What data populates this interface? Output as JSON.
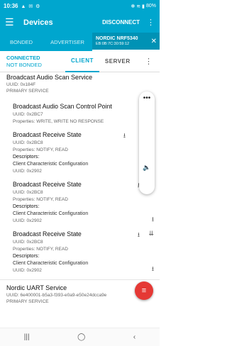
{
  "status": {
    "time": "10:36",
    "left_icons": "▲ ✉ ⚙",
    "right_icons": "✻ ≋ ▮",
    "battery": "80%"
  },
  "app": {
    "title": "Devices",
    "disconnect": "DISCONNECT"
  },
  "tabs": {
    "bonded": "BONDED",
    "advertiser": "ADVERTISER",
    "device_name": "NORDIC NRF5340",
    "device_mac": "EB:0B:7C:30:59:12"
  },
  "conn": {
    "status": "CONNECTED",
    "bond": "NOT BONDED",
    "client": "CLIENT",
    "server": "SERVER"
  },
  "services": [
    {
      "name": "Broadcast Audio Scan Service",
      "uuid": "UUID: 0x184F",
      "type": "PRIMARY SERVICE"
    },
    {
      "name": "Nordic UART Service",
      "uuid": "UUID: 6e400001-b5a3-f393-e0a9-e50e24dcca9e",
      "type": "PRIMARY SERVICE"
    }
  ],
  "chars": [
    {
      "name": "Broadcast Audio Scan Control Point",
      "uuid": "UUID: 0x2BC7",
      "props": "Properties: WRITE, WRITE NO RESPONSE"
    },
    {
      "name": "Broadcast Receive State",
      "uuid": "UUID: 0x2BC8",
      "props": "Properties: NOTIFY, READ",
      "desc_label": "Descriptors:",
      "desc_name": "Client Characteristic Configuration",
      "desc_uuid": "UUID: 0x2902"
    },
    {
      "name": "Broadcast Receive State",
      "uuid": "UUID: 0x2BC8",
      "props": "Properties: NOTIFY, READ",
      "desc_label": "Descriptors:",
      "desc_name": "Client Characteristic Configuration",
      "desc_uuid": "UUID: 0x2902"
    },
    {
      "name": "Broadcast Receive State",
      "uuid": "UUID: 0x2BC8",
      "props": "Properties: NOTIFY, READ",
      "desc_label": "Descriptors:",
      "desc_name": "Client Characteristic Configuration",
      "desc_uuid": "UUID: 0x2902"
    }
  ],
  "colors": {
    "accent": "#00a6ce",
    "fab": "#e53935"
  }
}
